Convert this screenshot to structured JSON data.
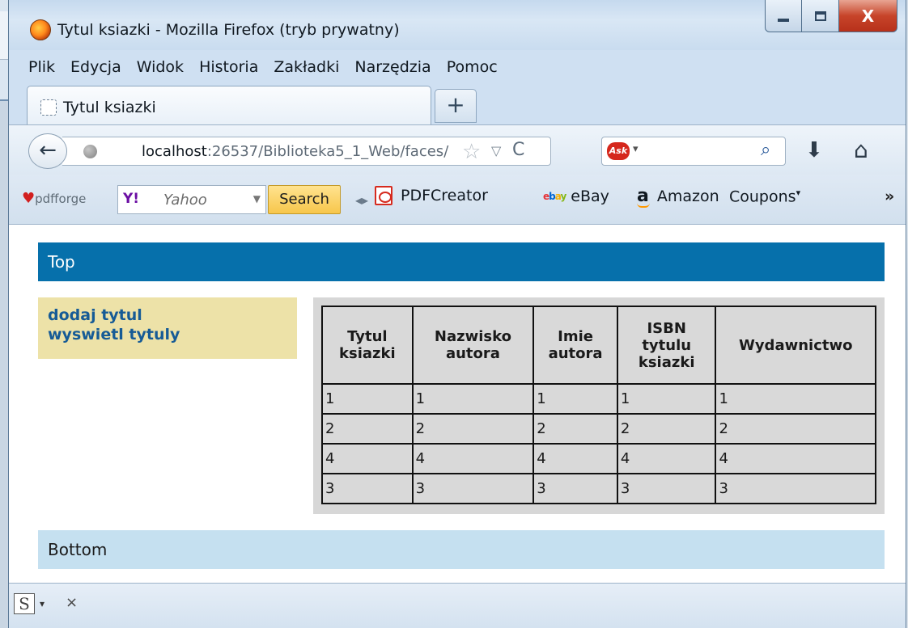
{
  "window": {
    "title": "Tytul ksiazki - Mozilla Firefox (tryb prywatny)",
    "controls": {
      "minimize": "",
      "maximize": "",
      "close": "X"
    }
  },
  "menu": [
    "Plik",
    "Edycja",
    "Widok",
    "Historia",
    "Zakładki",
    "Narzędzia",
    "Pomoc"
  ],
  "tabs": [
    {
      "title": "Tytul ksiazki"
    }
  ],
  "new_tab_label": "+",
  "navigation": {
    "url_host": "localhost",
    "url_rest": ":26537/Biblioteka5_1_Web/faces/",
    "search_engine_icon": "Ask",
    "star_icon": "☆",
    "dropdown_icon": "▽",
    "reload_icon": "C",
    "back_icon": "←",
    "download_icon": "⬇",
    "home_icon": "⌂",
    "search_icon": "⌕"
  },
  "toolbar": {
    "pdfforge": "pdfforge",
    "yahoo_logo": "Y!",
    "yahoo_placeholder": "Yahoo",
    "search_button": "Search",
    "bookmarks": [
      "PDFCreator",
      "eBay",
      "Amazon",
      "Coupons"
    ],
    "more": "»"
  },
  "page": {
    "top": "Top",
    "nav_links": [
      "dodaj tytul",
      "wyswietl tytuly"
    ],
    "table": {
      "headers": [
        "Tytul\nksiazki",
        "Nazwisko\nautora",
        "Imie\nautora",
        "ISBN\ntytulu\nksiazki",
        "Wydawnictwo"
      ],
      "rows": [
        [
          "1",
          "1",
          "1",
          "1",
          "1"
        ],
        [
          "2",
          "2",
          "2",
          "2",
          "2"
        ],
        [
          "4",
          "4",
          "4",
          "4",
          "4"
        ],
        [
          "3",
          "3",
          "3",
          "3",
          "3"
        ]
      ]
    },
    "bottom": "Bottom"
  },
  "statusbar": {
    "addon_icon": "S",
    "dropdown": "▾",
    "close": "×"
  },
  "colors": {
    "top_bar": "#0670ab",
    "nav_panel": "#ede2a8",
    "link": "#165b96",
    "table_panel": "#d7d7d7",
    "bottom_bar": "#c5e0f0",
    "search_button": "#f7c64b"
  }
}
